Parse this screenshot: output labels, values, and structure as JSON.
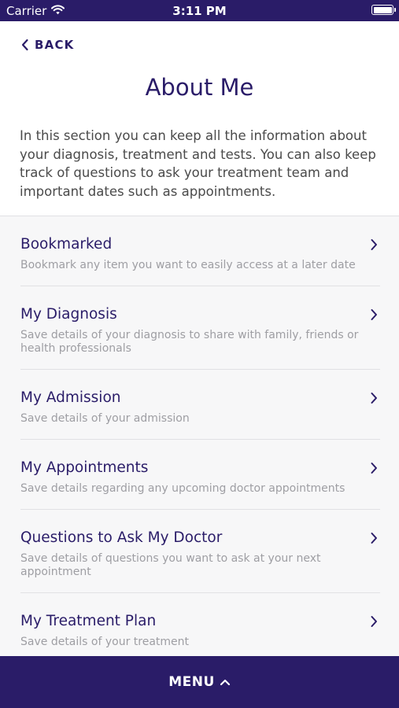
{
  "status_bar": {
    "carrier": "Carrier",
    "time": "3:11 PM"
  },
  "nav": {
    "back_label": "BACK"
  },
  "page": {
    "title": "About Me",
    "intro": "In this section you can keep all the information about your diagnosis, treatment and tests. You can also keep track of questions to ask your treatment team and important dates such as appointments."
  },
  "items": [
    {
      "title": "Bookmarked",
      "subtitle": "Bookmark any item you want to easily access at a later date"
    },
    {
      "title": "My Diagnosis",
      "subtitle": "Save details of your diagnosis to share with family, friends or health professionals"
    },
    {
      "title": "My Admission",
      "subtitle": "Save details of your admission"
    },
    {
      "title": "My Appointments",
      "subtitle": "Save details regarding any upcoming doctor appointments"
    },
    {
      "title": "Questions to Ask My Doctor",
      "subtitle": "Save details of questions you want to ask at your next appointment"
    },
    {
      "title": "My Treatment Plan",
      "subtitle": "Save details of your treatment"
    }
  ],
  "menu": {
    "label": "MENU"
  },
  "colors": {
    "brand": "#2a1c68",
    "list_bg": "#f7f7f8",
    "subtitle": "#9e9ea3",
    "body_text": "#4a4a4a"
  },
  "icons": {
    "back": "chevron-left-icon",
    "row": "chevron-right-icon",
    "menu": "chevron-up-icon",
    "wifi": "wifi-icon",
    "battery": "battery-icon"
  }
}
